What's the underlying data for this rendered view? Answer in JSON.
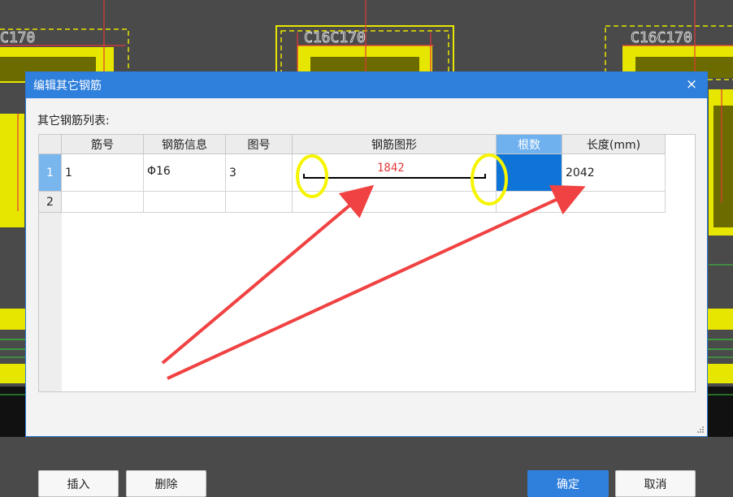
{
  "cad": {
    "labels": [
      "C170",
      "C16C170",
      "C16C170"
    ]
  },
  "dialog": {
    "title": "编辑其它钢筋",
    "close_glyph": "×",
    "list_label": "其它钢筋列表:",
    "columns": [
      "筋号",
      "钢筋信息",
      "图号",
      "钢筋图形",
      "根数",
      "长度(mm)"
    ],
    "rows": [
      {
        "index": "1",
        "bar_no": "1",
        "bar_info": "Φ16",
        "figure_no": "3",
        "shape_dim": "1842",
        "count": "",
        "length": "2042"
      },
      {
        "index": "2",
        "bar_no": "",
        "bar_info": "",
        "figure_no": "",
        "shape_dim": "",
        "count": "",
        "length": ""
      }
    ],
    "buttons": {
      "insert": "插入",
      "delete": "删除",
      "ok": "确定",
      "cancel": "取消"
    }
  },
  "colors": {
    "title_bar": "#2f7fdc",
    "selected_cell": "#0f74d8",
    "annotation_circle": "#f5f500",
    "annotation_arrow": "#f04242",
    "cad_yellow": "#e6e600",
    "cad_red": "#e23a3a"
  }
}
